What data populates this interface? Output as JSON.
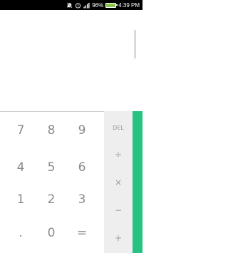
{
  "status_bar": {
    "battery_percent_text": "96%",
    "battery_level": 0.96,
    "time": "4:39 PM",
    "icons": [
      "mute-icon",
      "alarm-icon",
      "signal-icon",
      "battery-icon"
    ],
    "battery_color": "#8bc34a"
  },
  "display": {
    "value": ""
  },
  "keypad": {
    "digits": [
      "7",
      "8",
      "9",
      "4",
      "5",
      "6",
      "1",
      "2",
      "3",
      ".",
      "0",
      "="
    ],
    "operators": {
      "del": "DEL",
      "divide": "÷",
      "multiply": "×",
      "minus": "−",
      "plus": "+"
    }
  },
  "colors": {
    "advanced_panel": "#26c281",
    "operator_panel": "#eeeeee"
  }
}
